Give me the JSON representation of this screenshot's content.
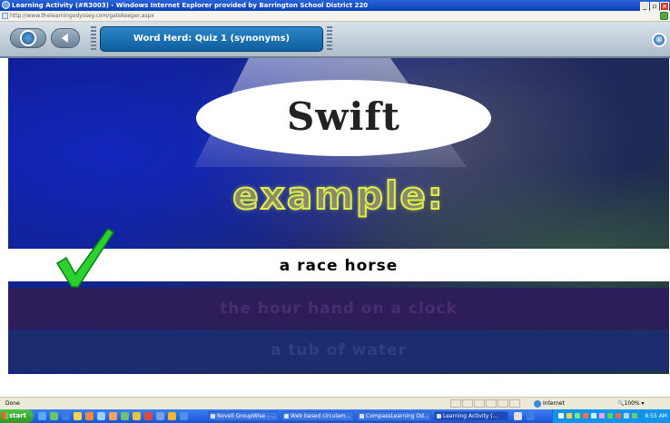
{
  "browser": {
    "window_title": "Learning Activity (#R3003) - Windows Internet Explorer provided by Barrington School District 220",
    "url": "http://www.thelearningodyssey.com/gatekeeper.aspx",
    "status_text": "Done",
    "zone": "Internet",
    "zoom": "100%"
  },
  "nav": {
    "activity_title": "Word Herd: Quiz 1 (synonyms)"
  },
  "quiz": {
    "word": "Swift",
    "example_label": "example:",
    "answers": [
      "a race horse",
      "the hour hand on a clock",
      "a tub of water"
    ],
    "selected_index": 0
  },
  "taskbar": {
    "start_label": "start",
    "tasks": [
      "Novell GroupWise - ...",
      "Web based circulam...",
      "CompassLearning Od...",
      "Learning Activity (..."
    ],
    "active_task": 3,
    "clock": "8:55 AM"
  },
  "colors": {
    "title_bar_blue": "#0a3fb5",
    "activity_title_bg": "#0d5f9e",
    "check_green": "#2bd12f",
    "example_outline": "#e0f045"
  },
  "icons": [
    "ie-icon",
    "home-icon",
    "back-icon",
    "exit-icon",
    "check-icon",
    "globe-icon",
    "windows-flag-icon"
  ]
}
